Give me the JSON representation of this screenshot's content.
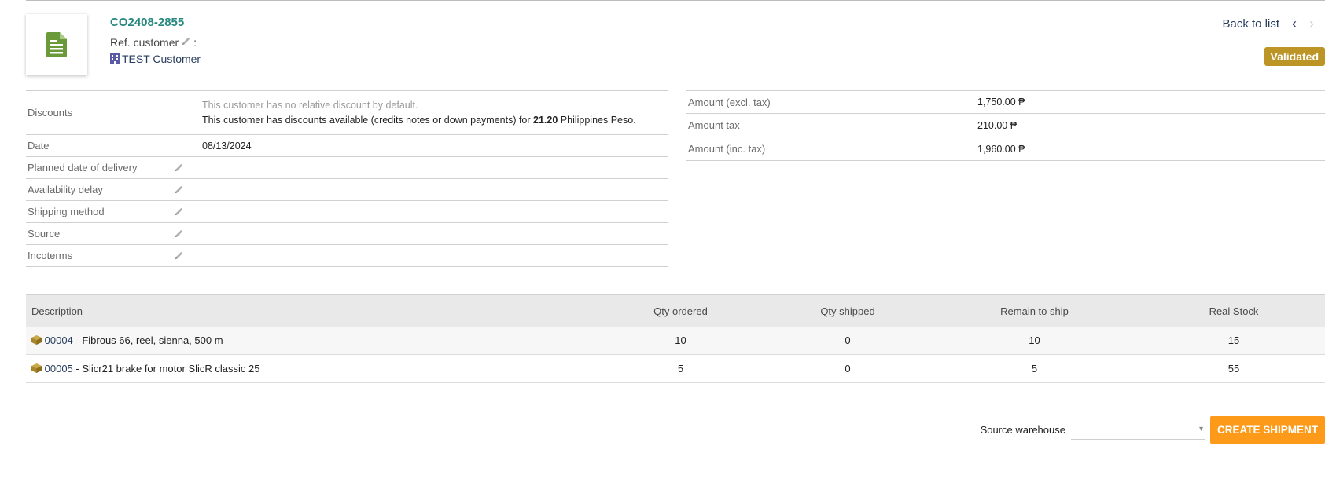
{
  "header": {
    "ref": "CO2408-2855",
    "ref_customer_label": "Ref. customer",
    "ref_customer_colon": ":",
    "customer": "TEST Customer",
    "back_label": "Back to list",
    "status": "Validated"
  },
  "fields": {
    "discounts_label": "Discounts",
    "discounts_line1": "This customer has no relative discount by default.",
    "discounts_line2_pre": "This customer has discounts available (credits notes or down payments) for ",
    "discounts_amount": "21.20",
    "discounts_line2_post": " Philippines Peso.",
    "date_label": "Date",
    "date_value": "08/13/2024",
    "planned_label": "Planned date of delivery",
    "availability_label": "Availability delay",
    "shipping_label": "Shipping method",
    "source_label": "Source",
    "incoterms_label": "Incoterms"
  },
  "amounts": {
    "excl_label": "Amount (excl. tax)",
    "excl_value": "1,750.00 ₱",
    "tax_label": "Amount tax",
    "tax_value": "210.00 ₱",
    "inc_label": "Amount (inc. tax)",
    "inc_value": "1,960.00 ₱"
  },
  "table": {
    "headers": [
      "Description",
      "Qty ordered",
      "Qty shipped",
      "Remain to ship",
      "Real Stock"
    ],
    "rows": [
      {
        "code": "00004",
        "desc": " - Fibrous 66, reel, sienna, 500 m",
        "ordered": "10",
        "shipped": "0",
        "remain": "10",
        "stock": "15"
      },
      {
        "code": "00005",
        "desc": " - Slicr21 brake for motor SlicR classic 25",
        "ordered": "5",
        "shipped": "0",
        "remain": "5",
        "stock": "55"
      }
    ]
  },
  "shipment": {
    "warehouse_label": "Source warehouse",
    "warehouse_value": "",
    "create_label": "CREATE SHIPMENT"
  },
  "colors": {
    "accent_teal": "#25877d",
    "badge": "#bc9526",
    "button": "#fd9a1a",
    "doc_icon": "#6a9a3a"
  }
}
